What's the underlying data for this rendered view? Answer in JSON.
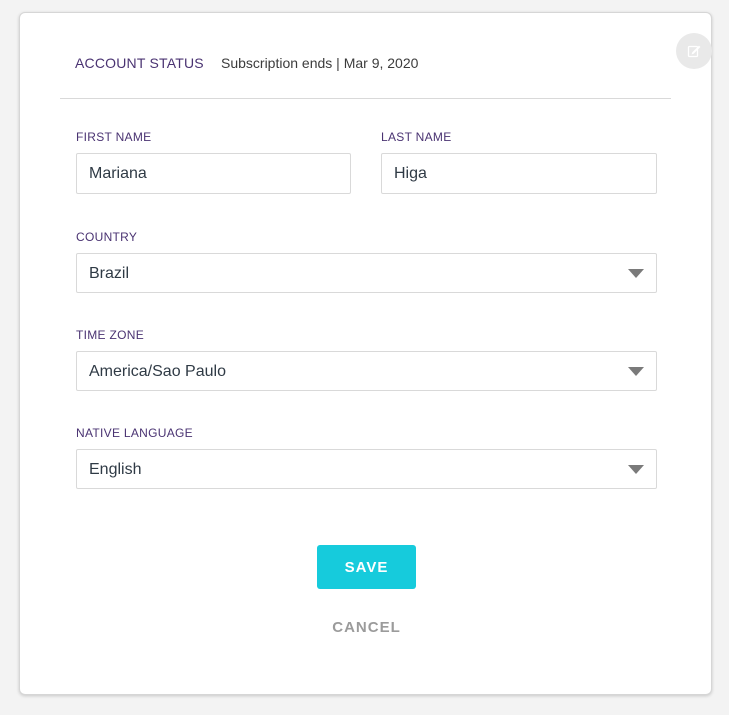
{
  "header": {
    "status_label": "ACCOUNT STATUS",
    "status_text": "Subscription ends | Mar 9, 2020",
    "edit_icon": "edit-icon"
  },
  "form": {
    "first_name": {
      "label": "FIRST NAME",
      "value": "Mariana"
    },
    "last_name": {
      "label": "LAST NAME",
      "value": "Higa"
    },
    "country": {
      "label": "COUNTRY",
      "value": "Brazil"
    },
    "time_zone": {
      "label": "TIME ZONE",
      "value": "America/Sao Paulo"
    },
    "native_language": {
      "label": "NATIVE LANGUAGE",
      "value": "English"
    }
  },
  "actions": {
    "save_label": "SAVE",
    "cancel_label": "CANCEL"
  },
  "colors": {
    "accent": "#16cbdc",
    "label": "#4a3372",
    "muted": "#9b9b9b"
  }
}
